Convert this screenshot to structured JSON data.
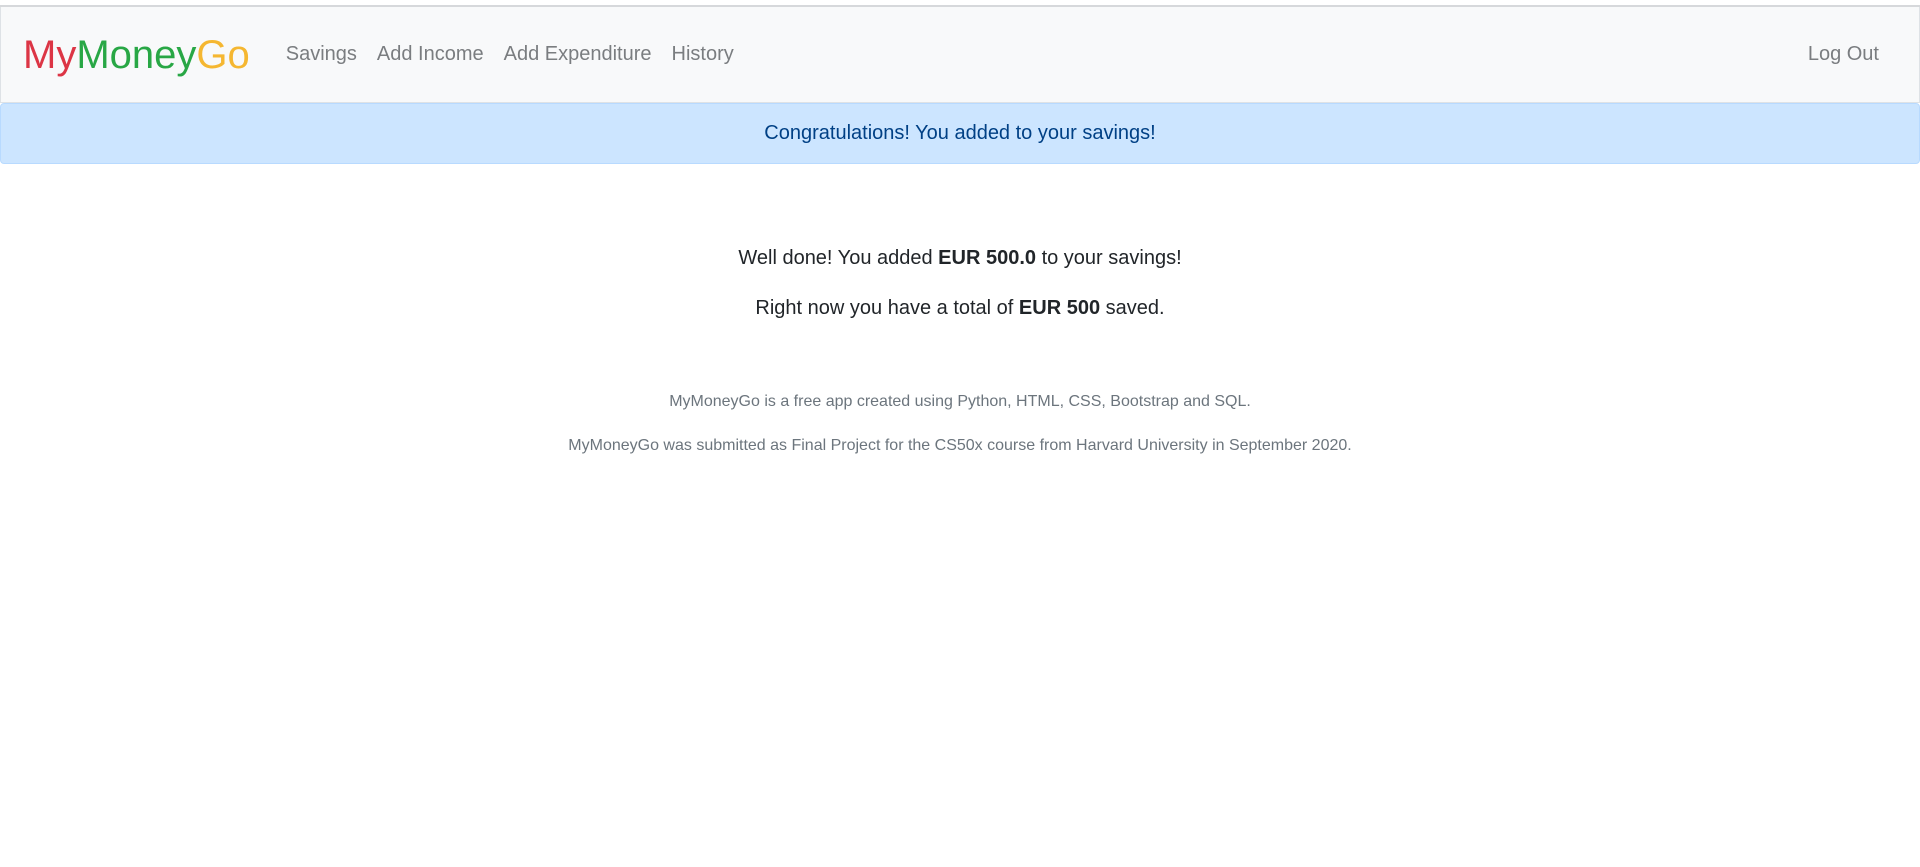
{
  "brand": {
    "parts": [
      {
        "text": "My",
        "color": "#dc3545"
      },
      {
        "text": "Money",
        "color": "#28a745"
      },
      {
        "text": "Go",
        "color": "#f5b731"
      }
    ]
  },
  "nav": {
    "items": [
      {
        "label": "Savings"
      },
      {
        "label": "Add Income"
      },
      {
        "label": "Add Expenditure"
      },
      {
        "label": "History"
      }
    ],
    "logout_label": "Log Out"
  },
  "alert": {
    "message": "Congratulations! You added to your savings!"
  },
  "main": {
    "line1_prefix": "Well done! You added ",
    "line1_amount": "EUR 500.0",
    "line1_suffix": " to your savings!",
    "line2_prefix": "Right now you have a total of ",
    "line2_amount": "EUR 500",
    "line2_suffix": " saved."
  },
  "footer": {
    "line1": "MyMoneyGo is a free app created using Python, HTML, CSS, Bootstrap and SQL.",
    "line2": "MyMoneyGo was submitted as Final Project for the CS50x course from Harvard University in September 2020."
  }
}
